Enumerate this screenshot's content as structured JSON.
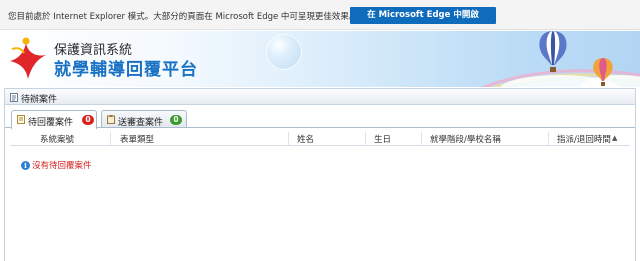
{
  "ie_bar": {
    "message": "您目前處於 Internet Explorer 模式。大部分的頁面在 Microsoft Edge 中可呈現更佳效果。",
    "button_label": "在 Microsoft Edge 中開啟"
  },
  "header": {
    "system_name": "保護資訊系統",
    "platform_name": "就學輔導回覆平台"
  },
  "panel": {
    "title": "待辦案件",
    "tabs": [
      {
        "label": "待回覆案件",
        "count": "0",
        "badge_color": "#d9231d",
        "active": true
      },
      {
        "label": "送審查案件",
        "count": "0",
        "badge_color": "#3a9a2c",
        "active": false
      }
    ],
    "columns": [
      "系統案號",
      "表單類型",
      "姓名",
      "生日",
      "就學階段/學校名稱",
      "指派/退回時間"
    ],
    "sort_icon": "sort-ascending-icon",
    "empty_message": "沒有待回覆案件"
  }
}
